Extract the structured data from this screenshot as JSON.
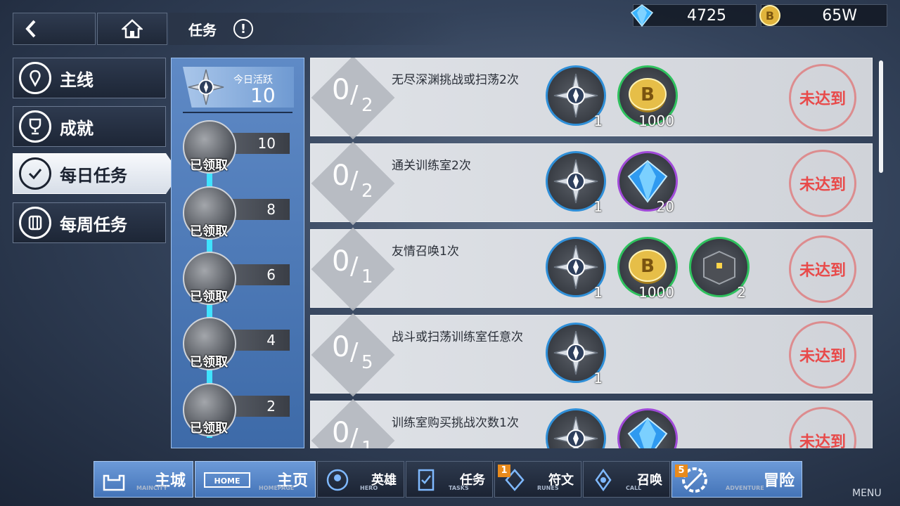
{
  "top": {
    "title": "任务",
    "currencies": [
      {
        "icon": "gem-icon",
        "value": "4725"
      },
      {
        "icon": "gold-coin-icon",
        "value": "65W"
      }
    ]
  },
  "menu": {
    "items": [
      {
        "label": "主线",
        "active": false
      },
      {
        "label": "成就",
        "active": false
      },
      {
        "label": "每日任务",
        "active": true
      },
      {
        "label": "每周任务",
        "active": false
      }
    ]
  },
  "activity": {
    "label": "今日活跃",
    "value": "10",
    "milestones": [
      {
        "points": "10",
        "status": "已领取"
      },
      {
        "points": "8",
        "status": "已领取"
      },
      {
        "points": "6",
        "status": "已领取"
      },
      {
        "points": "4",
        "status": "已领取"
      },
      {
        "points": "2",
        "status": "已领取"
      }
    ]
  },
  "tasks": [
    {
      "name": "无尽深渊挑战或扫荡2次",
      "progress": "0",
      "total": "2",
      "status": "未达到",
      "rewards": [
        {
          "type": "compass",
          "frame": "blue",
          "count": "1"
        },
        {
          "type": "gold-coin",
          "frame": "green",
          "count": "1000"
        }
      ]
    },
    {
      "name": "通关训练室2次",
      "progress": "0",
      "total": "2",
      "status": "未达到",
      "rewards": [
        {
          "type": "compass",
          "frame": "blue",
          "count": "1"
        },
        {
          "type": "gem",
          "frame": "purple",
          "count": "20"
        }
      ]
    },
    {
      "name": "友情召唤1次",
      "progress": "0",
      "total": "1",
      "status": "未达到",
      "rewards": [
        {
          "type": "compass",
          "frame": "blue",
          "count": "1"
        },
        {
          "type": "gold-coin",
          "frame": "green",
          "count": "1000"
        },
        {
          "type": "cube",
          "frame": "green",
          "count": "2"
        }
      ]
    },
    {
      "name": "战斗或扫荡训练室任意次",
      "progress": "0",
      "total": "5",
      "status": "未达到",
      "rewards": [
        {
          "type": "compass",
          "frame": "blue",
          "count": "1"
        }
      ]
    },
    {
      "name": "训练室购买挑战次数1次",
      "progress": "0",
      "total": "1",
      "status": "未达到",
      "rewards": [
        {
          "type": "compass",
          "frame": "blue",
          "count": ""
        },
        {
          "type": "gem",
          "frame": "purple",
          "count": ""
        }
      ]
    }
  ],
  "nav": {
    "items": [
      {
        "label": "主城",
        "eng": "MAINCITY",
        "badge": ""
      },
      {
        "label": "主页",
        "eng": "HOMEPAGE",
        "badge": ""
      },
      {
        "label": "英雄",
        "eng": "HERO",
        "badge": ""
      },
      {
        "label": "任务",
        "eng": "TASKS",
        "badge": ""
      },
      {
        "label": "符文",
        "eng": "RUNES",
        "badge": "1"
      },
      {
        "label": "召唤",
        "eng": "CALL",
        "badge": ""
      },
      {
        "label": "冒险",
        "eng": "ADVENTURE",
        "badge": "5"
      }
    ],
    "menu_label": "MENU"
  },
  "colors": {
    "accent_blue": "#5f8ac6",
    "stamp_red": "#e84a4a",
    "rail_cyan": "#3fe3ff"
  }
}
